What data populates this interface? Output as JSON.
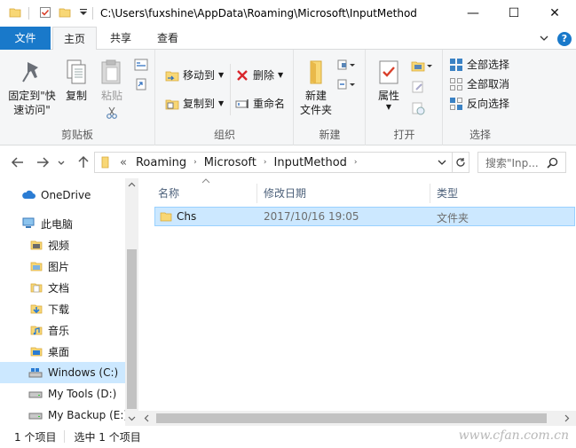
{
  "window": {
    "title": "C:\\Users\\fuxshine\\AppData\\Roaming\\Microsoft\\InputMethod",
    "minimize": "—",
    "maximize": "☐",
    "close": "✕"
  },
  "tabs": {
    "file": "文件",
    "home": "主页",
    "share": "共享",
    "view": "查看",
    "help": "?"
  },
  "ribbon": {
    "clipboard": {
      "pin_line1": "固定到\"快",
      "pin_line2": "速访问\"",
      "copy": "复制",
      "paste": "粘贴",
      "label": "剪贴板"
    },
    "organize": {
      "move_to": "移动到",
      "copy_to": "复制到",
      "delete": "删除",
      "rename": "重命名",
      "label": "组织"
    },
    "new": {
      "new_folder_line1": "新建",
      "new_folder_line2": "文件夹",
      "label": "新建"
    },
    "open": {
      "properties": "属性",
      "label": "打开"
    },
    "select": {
      "select_all": "全部选择",
      "select_none": "全部取消",
      "invert": "反向选择",
      "label": "选择"
    }
  },
  "address": {
    "overflow": "«",
    "crumbs": [
      "Roaming",
      "Microsoft",
      "InputMethod"
    ],
    "search_placeholder": "搜索\"Inp..."
  },
  "nav": {
    "onedrive": "OneDrive",
    "this_pc": "此电脑",
    "videos": "视频",
    "pictures": "图片",
    "documents": "文档",
    "downloads": "下载",
    "music": "音乐",
    "desktop": "桌面",
    "drive_c": "Windows (C:)",
    "drive_d": "My Tools (D:)",
    "drive_e": "My Backup (E:)"
  },
  "columns": {
    "name": "名称",
    "modified": "修改日期",
    "type": "类型"
  },
  "files": [
    {
      "name": "Chs",
      "modified": "2017/10/16 19:05",
      "type": "文件夹"
    }
  ],
  "status": {
    "count": "1 个项目",
    "selected": "选中 1 个项目"
  },
  "watermark": "www.cfan.com.cn",
  "colors": {
    "accent": "#1979ca",
    "selection": "#cce8ff",
    "folder": "#f8d775"
  }
}
